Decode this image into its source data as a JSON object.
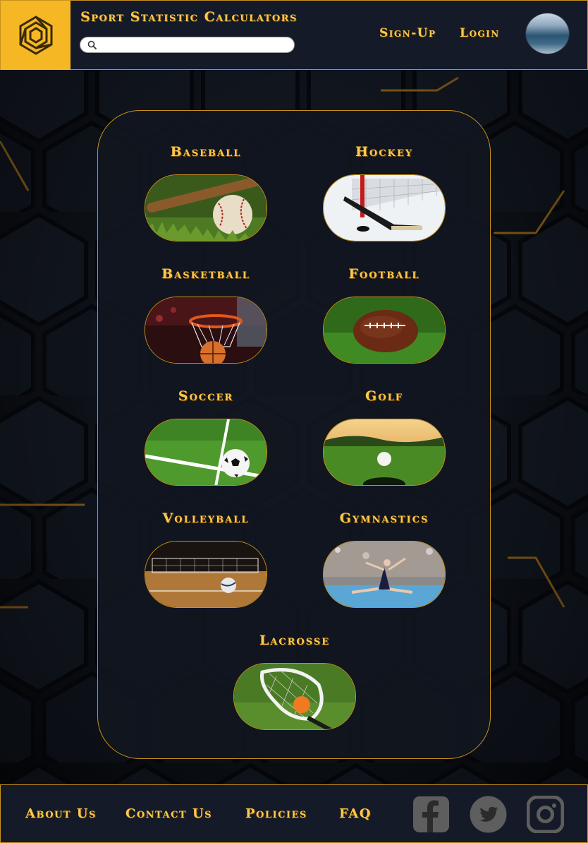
{
  "header": {
    "title": "Sport Statistic Calculators",
    "search": {
      "value": "",
      "placeholder": ""
    },
    "nav": {
      "signup": "Sign-Up",
      "login": "Login"
    },
    "logo_icon": "hexagon-spiral-logo",
    "avatar_icon": "profile-avatar"
  },
  "sports": [
    {
      "label": "Baseball",
      "image": "baseball-on-grass"
    },
    {
      "label": "Hockey",
      "image": "hockey-stick-and-net"
    },
    {
      "label": "Basketball",
      "image": "basketball-hoop"
    },
    {
      "label": "Football",
      "image": "football-on-grass"
    },
    {
      "label": "Soccer",
      "image": "soccer-ball-on-field"
    },
    {
      "label": "Golf",
      "image": "golf-ball-near-hole"
    },
    {
      "label": "Volleyball",
      "image": "volleyball-court"
    },
    {
      "label": "Gymnastics",
      "image": "gymnast-split"
    },
    {
      "label": "Lacrosse",
      "image": "lacrosse-stick-and-ball"
    }
  ],
  "footer": {
    "links": {
      "about": "About Us",
      "contact": "Contact Us",
      "policies": "Policies",
      "faq": "FAQ"
    },
    "social": [
      "facebook-icon",
      "twitter-icon",
      "instagram-icon"
    ]
  },
  "colors": {
    "accent": "#ffc94a",
    "border": "#c9911c",
    "logo_bg": "#f5b824",
    "bar_bg": "#141a27",
    "page_bg": "#0d121d"
  }
}
